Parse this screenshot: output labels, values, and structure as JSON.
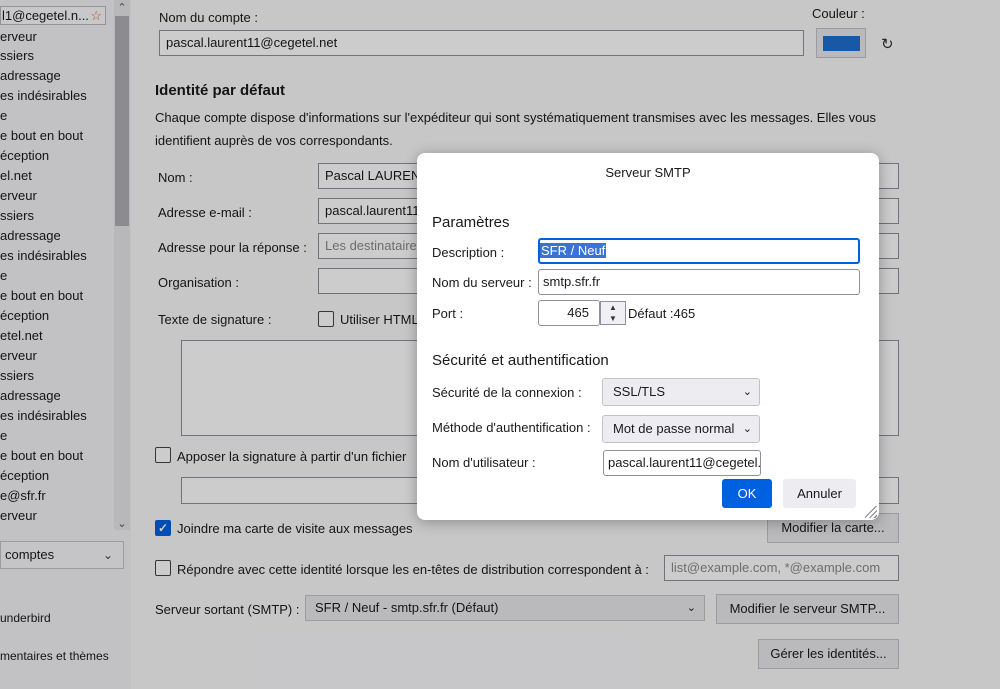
{
  "sidebar": {
    "account_top": "l1@cegetel.n...",
    "items": [
      "erveur",
      "ssiers",
      "adressage",
      "es indésirables",
      "e",
      "e bout en bout",
      "éception",
      "el.net",
      "erveur",
      "ssiers",
      "adressage",
      "es indésirables",
      "e",
      "e bout en bout",
      "éception",
      "etel.net",
      "erveur",
      "ssiers",
      "adressage",
      "es indésirables",
      "e",
      "e bout en bout",
      "éception",
      "e@sfr.fr",
      "erveur"
    ],
    "comptes_label": "comptes",
    "bottom_items": [
      "underbird",
      "mentaires et thèmes"
    ]
  },
  "main": {
    "account_name_label": "Nom du compte :",
    "account_name_value": "pascal.laurent11@cegetel.net",
    "color_label": "Couleur :",
    "identity_heading": "Identité par défaut",
    "identity_desc_1": "Chaque compte dispose d'informations sur l'expéditeur qui sont systématiquement transmises avec les messages. Elles vous",
    "identity_desc_2": "identifient auprès de vos correspondants.",
    "name_label": "Nom :",
    "name_value": "Pascal LAURENT",
    "email_label": "Adresse e-mail :",
    "email_value": "pascal.laurent11",
    "reply_label": "Adresse pour la réponse :",
    "reply_placeholder": "Les destinataire",
    "org_label": "Organisation :",
    "sig_label": "Texte de signature :",
    "use_html_label": "Utiliser HTML",
    "attach_sig_label": "Apposer la signature à partir d'un fichier",
    "vcard_label": "Joindre ma carte de visite aux messages",
    "edit_card_button": "Modifier la carte...",
    "reply_identity_label": "Répondre avec cette identité lorsque les en-têtes de distribution correspondent à :",
    "reply_identity_placeholder": "list@example.com, *@example.com",
    "smtp_label": "Serveur sortant (SMTP) :",
    "smtp_value": "SFR / Neuf - smtp.sfr.fr (Défaut)",
    "edit_smtp_button": "Modifier le serveur SMTP...",
    "manage_identities_button": "Gérer les identités..."
  },
  "dialog": {
    "title": "Serveur SMTP",
    "params_heading": "Paramètres",
    "description_label": "Description :",
    "description_value": "SFR / Neuf",
    "server_label": "Nom du serveur :",
    "server_value": "smtp.sfr.fr",
    "port_label": "Port :",
    "port_value": "465",
    "default_port": "Défaut :465",
    "security_heading": "Sécurité et authentification",
    "conn_security_label": "Sécurité de la connexion :",
    "conn_security_value": "SSL/TLS",
    "auth_method_label": "Méthode d'authentification :",
    "auth_method_value": "Mot de passe normal",
    "username_label": "Nom d'utilisateur :",
    "username_value": "pascal.laurent11@cegetel.",
    "ok_label": "OK",
    "cancel_label": "Annuler"
  },
  "colors": {
    "accent": "#0061e0",
    "account_color": "#1f6fd1"
  }
}
